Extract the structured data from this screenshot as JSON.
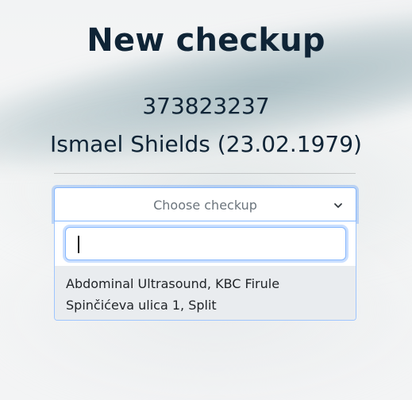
{
  "page": {
    "title": "New checkup"
  },
  "patient": {
    "id": "373823237",
    "name_line": "Ismael Shields (23.02.1979)"
  },
  "checkup_select": {
    "selected_placeholder": "Choose checkup",
    "icon": "chevron-down-icon"
  },
  "dropdown": {
    "search": {
      "value": "",
      "placeholder": ""
    },
    "options": [
      {
        "line1": "Abdominal Ultrasound, KBC Firule",
        "line2": "Spinčićeva ulica 1, Split"
      }
    ]
  },
  "colors": {
    "heading": "#0f2436",
    "focus_border": "#86b7fe",
    "option_highlight": "#e9ecef",
    "placeholder": "#6c757d"
  }
}
